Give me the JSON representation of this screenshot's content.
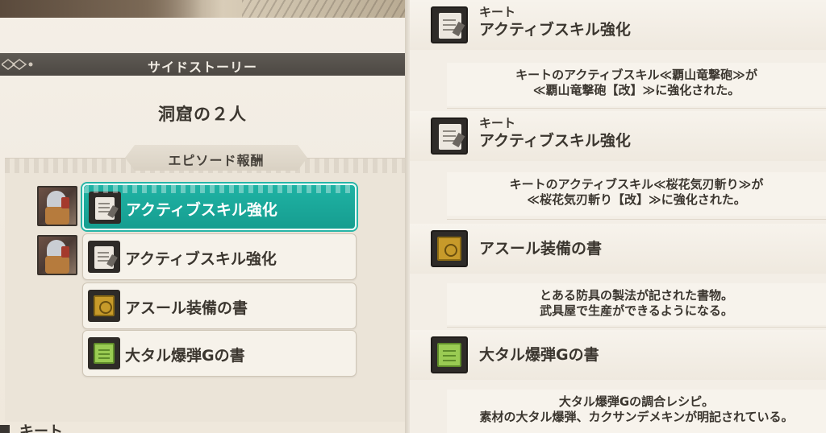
{
  "left_panel": {
    "banner_title": "サイドストーリー",
    "story_title": "洞窟の２人",
    "episode_reward_label": "エピソード報酬",
    "rewards": [
      {
        "label": "アクティブスキル強化",
        "icon": "scroll-icon",
        "has_portrait": true,
        "selected": true
      },
      {
        "label": "アクティブスキル強化",
        "icon": "scroll-icon",
        "has_portrait": true,
        "selected": false
      },
      {
        "label": "アスール装備の書",
        "icon": "gold-book-icon",
        "has_portrait": false,
        "selected": false
      },
      {
        "label": "大タル爆弾Gの書",
        "icon": "green-book-icon",
        "has_portrait": false,
        "selected": false
      }
    ],
    "footer_peek_text": "キート"
  },
  "right_panel": {
    "details": [
      {
        "owner": "キート",
        "name": "アクティブスキル強化",
        "icon": "scroll-icon",
        "description_line1": "キートのアクティブスキル≪覇山竜撃砲≫が",
        "description_line2": "≪覇山竜撃砲【改】≫に強化された。"
      },
      {
        "owner": "キート",
        "name": "アクティブスキル強化",
        "icon": "scroll-icon",
        "description_line1": "キートのアクティブスキル≪桜花気刃斬り≫が",
        "description_line2": "≪桜花気刃斬り【改】≫に強化された。"
      },
      {
        "owner": "",
        "name": "アスール装備の書",
        "icon": "gold-book-icon",
        "description_line1": "とある防具の製法が記された書物。",
        "description_line2": "武具屋で生産ができるようになる。"
      },
      {
        "owner": "",
        "name": "大タル爆弾Gの書",
        "icon": "green-book-icon",
        "description_line1": "大タル爆弾Gの調合レシピ。",
        "description_line2": "素材の大タル爆弾、カクサンデメキンが明記されている。"
      }
    ]
  },
  "colors": {
    "accent_teal": "#1fb3a4",
    "banner_gray": "#55504a",
    "parchment": "#efe9df"
  }
}
